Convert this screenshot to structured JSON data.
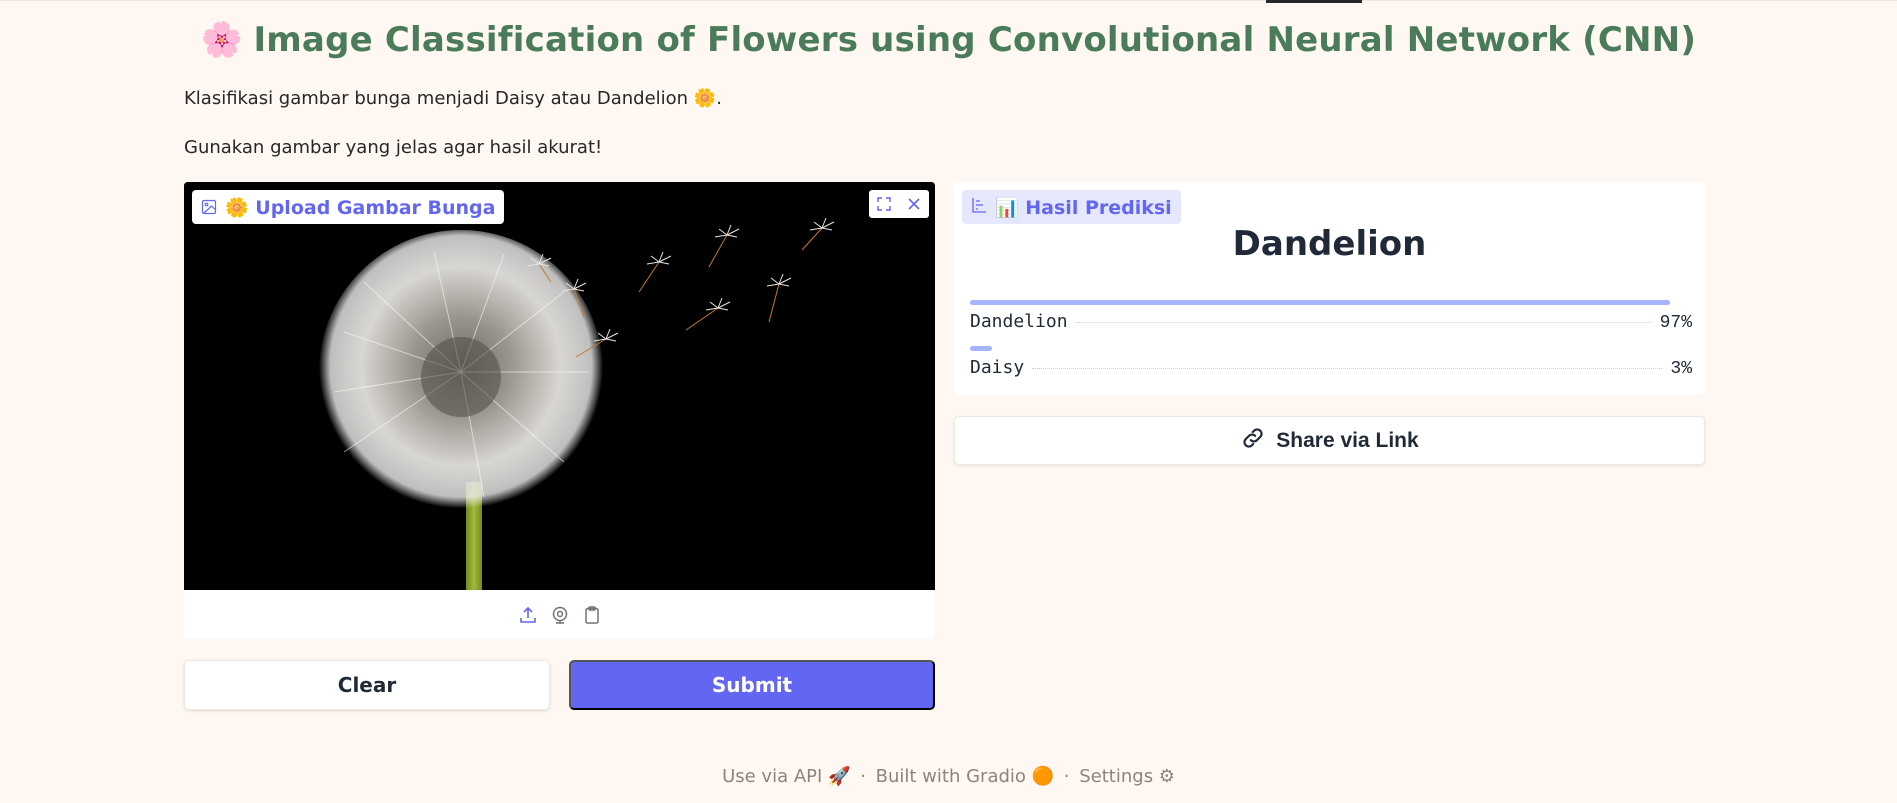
{
  "header": {
    "title": "Image Classification of Flowers using Convolutional Neural Network (CNN)",
    "title_emoji": "🌸"
  },
  "description": {
    "line1": "Klasifikasi gambar bunga menjadi Daisy atau Dandelion 🌼.",
    "line2": "Gunakan gambar yang jelas agar hasil akurat!"
  },
  "input_panel": {
    "label": "🌼 Upload Gambar Bunga",
    "icon": "image-icon",
    "tools": [
      "fullscreen-icon",
      "close-icon"
    ],
    "sources": [
      "upload-icon",
      "webcam-icon",
      "clipboard-icon"
    ]
  },
  "buttons": {
    "clear": "Clear",
    "submit": "Submit",
    "share": "Share via Link"
  },
  "output_panel": {
    "label": "📊 Hasil Prediksi",
    "icon": "bar-chart-icon",
    "top_label": "Dandelion",
    "confidences": [
      {
        "label": "Dandelion",
        "value": 0.97,
        "pct": "97%"
      },
      {
        "label": "Daisy",
        "value": 0.03,
        "pct": "3%"
      }
    ]
  },
  "footer": {
    "api": "Use via API 🚀",
    "sep1": "·",
    "built": "Built with Gradio 🟠",
    "sep2": "·",
    "settings": "Settings ⚙"
  },
  "colors": {
    "background": "#fff7f1",
    "title": "#4a7c59",
    "accent": "#6366f1",
    "bar": "#a5b4fc"
  }
}
